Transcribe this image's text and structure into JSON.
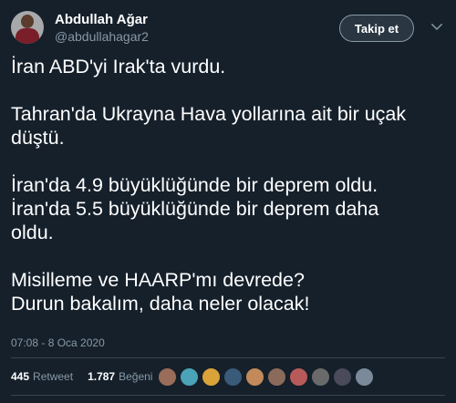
{
  "author": {
    "display_name": "Abdullah Ağar",
    "username": "@abdullahagar2"
  },
  "follow_label": "Takip et",
  "tweet_lines": [
    "İran ABD'yi Irak'ta vurdu.",
    "",
    "Tahran'da Ukrayna Hava yollarına ait bir uçak",
    "düştü.",
    "",
    "İran'da 4.9 büyüklüğünde bir deprem oldu.",
    "İran'da 5.5 büyüklüğünde bir deprem daha",
    "oldu.",
    "",
    "Misilleme ve HAARP'mı devrede?",
    "Durun bakalım, daha neler olacak!"
  ],
  "timestamp": "07:08 - 8 Oca 2020",
  "stats": {
    "retweets": "445",
    "retweets_label": "Retweet",
    "likes": "1.787",
    "likes_label": "Beğeni"
  },
  "liker_colors": [
    "#9a6d5a",
    "#4aa3b8",
    "#d9a33a",
    "#3a5a7a",
    "#c28a5a",
    "#8a6a5a",
    "#b85a5a",
    "#6a6a6a",
    "#4a4a5a",
    "#7a8a9a"
  ]
}
